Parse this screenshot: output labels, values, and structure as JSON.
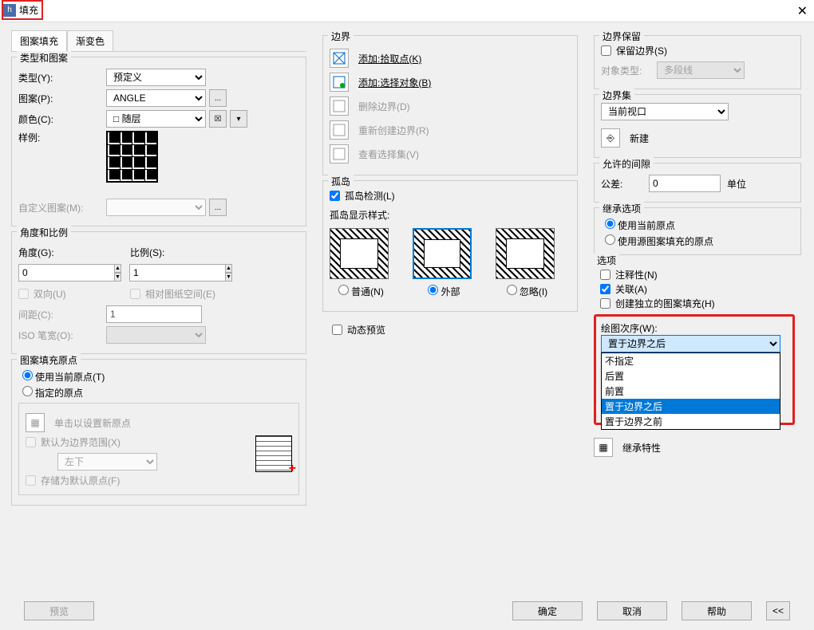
{
  "window": {
    "title": "填充"
  },
  "tabs": {
    "pattern": "图案填充",
    "gradient": "渐变色"
  },
  "typePattern": {
    "group": "类型和图案",
    "typeLabel": "类型(Y):",
    "typeValue": "预定义",
    "patternLabel": "图案(P):",
    "patternValue": "ANGLE",
    "colorLabel": "颜色(C):",
    "colorValue": "随层",
    "sampleLabel": "样例:",
    "customLabel": "自定义图案(M):"
  },
  "angleScale": {
    "group": "角度和比例",
    "angleLabel": "角度(G):",
    "angleValue": "0",
    "scaleLabel": "比例(S):",
    "scaleValue": "1",
    "doubleLabel": "双向(U)",
    "relPaperLabel": "相对图纸空间(E)",
    "spacingLabel": "间距(C):",
    "spacingValue": "1",
    "isoPenLabel": "ISO 笔宽(O):"
  },
  "origin": {
    "group": "图案填充原点",
    "useCurrentLabel": "使用当前原点(T)",
    "specifyLabel": "指定的原点",
    "clickNewLabel": "单击以设置新原点",
    "defaultBoundaryLabel": "默认为边界范围(X)",
    "posValue": "左下",
    "storeDefaultLabel": "存储为默认原点(F)"
  },
  "boundary": {
    "group": "边界",
    "addPick": "添加:拾取点(K)",
    "addSelect": "添加:选择对象(B)",
    "removeBoundary": "删除边界(D)",
    "recreateBoundary": "重新创建边界(R)",
    "viewSelection": "查看选择集(V)"
  },
  "island": {
    "group": "孤岛",
    "detectLabel": "孤岛检测(L)",
    "styleLabel": "孤岛显示样式:",
    "normal": "普通(N)",
    "outer": "外部",
    "ignore": "忽略(I)"
  },
  "dynamicPreview": "动态预览",
  "boundaryKeep": {
    "group": "边界保留",
    "keepLabel": "保留边界(S)",
    "objTypeLabel": "对象类型:",
    "objTypeValue": "多段线"
  },
  "boundarySet": {
    "group": "边界集",
    "value": "当前视口",
    "newLabel": "新建"
  },
  "gap": {
    "group": "允许的间隙",
    "tolLabel": "公差:",
    "tolValue": "0",
    "unitLabel": "单位"
  },
  "inherit": {
    "group": "继承选项",
    "useCurrentOrigin": "使用当前原点",
    "useSourceOrigin": "使用源图案填充的原点"
  },
  "options": {
    "group": "选项",
    "annotative": "注释性(N)",
    "associative": "关联(A)",
    "independent": "创建独立的图案填充(H)",
    "drawOrderLabel": "绘图次序(W):",
    "drawOrderValue": "置于边界之后",
    "ddOptions": {
      "0": "不指定",
      "1": "后置",
      "2": "前置",
      "3": "置于边界之后",
      "4": "置于边界之前"
    }
  },
  "inheritProps": "继承特性",
  "buttons": {
    "preview": "预览",
    "ok": "确定",
    "cancel": "取消",
    "help": "帮助"
  }
}
